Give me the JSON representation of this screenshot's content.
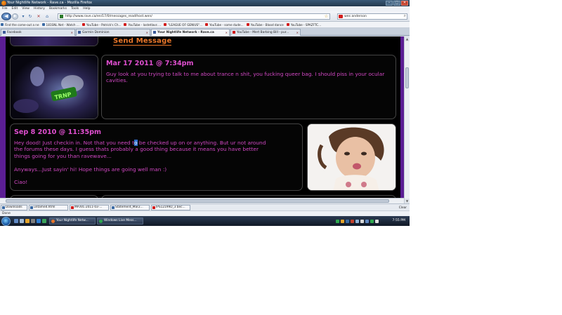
{
  "window": {
    "title": "Your Nightlife Network - Rave.ca - Mozilla Firefox",
    "controls": [
      "–",
      "□",
      "✕"
    ]
  },
  "menu": [
    "File",
    "Edit",
    "View",
    "History",
    "Bookmarks",
    "Tools",
    "Help"
  ],
  "nav": {
    "url": "http://www.rave.ca/en/17/0/messages_read/host.wen/",
    "search_value": "wes anderson"
  },
  "bookmarks": [
    "Find the come-out a ne",
    "181SNL Net - Watch ...",
    "YouTube - Patrick's Ch...",
    "YouTube - lostetlavs ...",
    "\"LEAGUE OF GENIUS\"...",
    "YouTube - some dude...",
    "YouTube - Blood dance",
    "YouTube - SPAZFTC..."
  ],
  "tabs": [
    {
      "label": "Facebook",
      "active": false
    },
    {
      "label": "Garmin Dominion",
      "active": false
    },
    {
      "label": "Your Nightlife Network - Rave.ca",
      "active": true
    },
    {
      "label": "YouTube - Mert Barbing Bill - pur...",
      "active": false
    }
  ],
  "page": {
    "send_message": "Send Message",
    "messages": [
      {
        "date": "Mar 17 2011 @ 7:34pm",
        "body": "Guy look at you trying to talk to me about trance n shit, you fucking queer bag. I should piss in your ocular cavities."
      },
      {
        "date": "Sep 8 2010 @ 11:35pm",
        "line1_a": "Hey dood! Just checkin in. Not that you need t",
        "line1_sel": "o",
        "line1_b": " be checked up on or anything. But ur not around",
        "line2": "the forums these days. I guess thats probably a good thing because it means you have better",
        "line3": "things going for you than ravewave...",
        "line4": "Anyways...Just sayin' hi! Hope things are going well man :)",
        "line5": "Ciao!"
      }
    ]
  },
  "downloads": {
    "label": "Downloads",
    "items": [
      "untamed.html",
      "MP3VL-2011-03-...",
      "Statement_Mar2...",
      "IPS12199D_3 bec..."
    ],
    "clear": "Clear"
  },
  "status": "Done",
  "taskbar": {
    "tasks": [
      "Your Nightlife Netw...",
      "Windows Live Mess..."
    ],
    "clock": "7:55 PM"
  },
  "colors": {
    "accent_orange": "#e8762a",
    "message_pink": "#d248c4",
    "page_purple": "#5b1e94"
  }
}
